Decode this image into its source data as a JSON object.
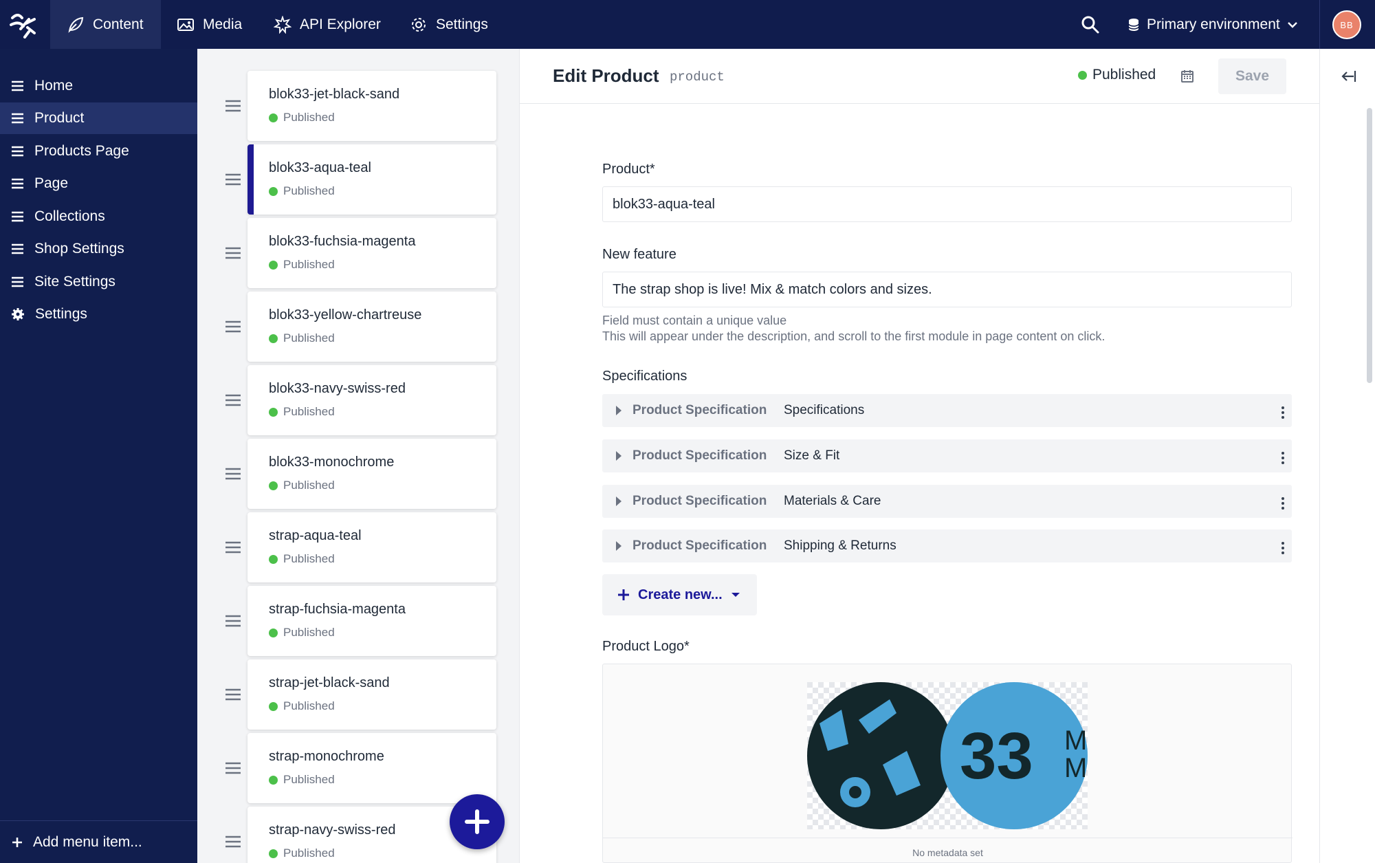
{
  "topbar": {
    "nav": [
      {
        "label": "Content",
        "icon": "leaf-icon",
        "active": true
      },
      {
        "label": "Media",
        "icon": "image-icon"
      },
      {
        "label": "API Explorer",
        "icon": "api-icon"
      },
      {
        "label": "Settings",
        "icon": "gear-icon"
      }
    ],
    "environment": "Primary environment",
    "avatar_initials": "BB"
  },
  "sidebar": {
    "items": [
      {
        "label": "Home",
        "icon": "menu-icon"
      },
      {
        "label": "Product",
        "icon": "menu-icon",
        "active": true
      },
      {
        "label": "Products Page",
        "icon": "menu-icon"
      },
      {
        "label": "Page",
        "icon": "menu-icon"
      },
      {
        "label": "Collections",
        "icon": "menu-icon"
      },
      {
        "label": "Shop Settings",
        "icon": "menu-icon"
      },
      {
        "label": "Site Settings",
        "icon": "menu-icon"
      },
      {
        "label": "Settings",
        "icon": "gear-icon"
      }
    ],
    "add_item_label": "Add menu item..."
  },
  "list": {
    "status_color": "#4cc04a",
    "items": [
      {
        "title": "blok33-jet-black-sand",
        "status": "Published"
      },
      {
        "title": "blok33-aqua-teal",
        "status": "Published",
        "selected": true
      },
      {
        "title": "blok33-fuchsia-magenta",
        "status": "Published"
      },
      {
        "title": "blok33-yellow-chartreuse",
        "status": "Published"
      },
      {
        "title": "blok33-navy-swiss-red",
        "status": "Published"
      },
      {
        "title": "blok33-monochrome",
        "status": "Published"
      },
      {
        "title": "strap-aqua-teal",
        "status": "Published"
      },
      {
        "title": "strap-fuchsia-magenta",
        "status": "Published"
      },
      {
        "title": "strap-jet-black-sand",
        "status": "Published"
      },
      {
        "title": "strap-monochrome",
        "status": "Published"
      },
      {
        "title": "strap-navy-swiss-red",
        "status": "Published"
      }
    ]
  },
  "editor": {
    "title": "Edit Product",
    "type": "product",
    "status": "Published",
    "save_label": "Save",
    "fields": {
      "product_label": "Product*",
      "product_value": "blok33-aqua-teal",
      "feature_label": "New feature",
      "feature_value": "The strap shop is live! Mix & match colors and sizes.",
      "feature_help_1": "Field must contain a unique value",
      "feature_help_2": "This will appear under the description, and scroll to the first module in page content on click.",
      "specs_label": "Specifications",
      "specs": [
        {
          "type": "Product Specification",
          "name": "Specifications"
        },
        {
          "type": "Product Specification",
          "name": "Size & Fit"
        },
        {
          "type": "Product Specification",
          "name": "Materials & Care"
        },
        {
          "type": "Product Specification",
          "name": "Shipping & Returns"
        }
      ],
      "create_new_label": "Create new...",
      "logo_label": "Product Logo*",
      "logo_text": "33",
      "logo_unit_1": "M",
      "logo_unit_2": "M",
      "logo_meta": "No metadata set"
    }
  },
  "colors": {
    "topbar": "#101c4d",
    "sidebar": "#111e4e",
    "accent": "#1c1a9a",
    "published": "#4cc04a",
    "logo_dark": "#13272b",
    "logo_blue": "#4aa3d6"
  }
}
